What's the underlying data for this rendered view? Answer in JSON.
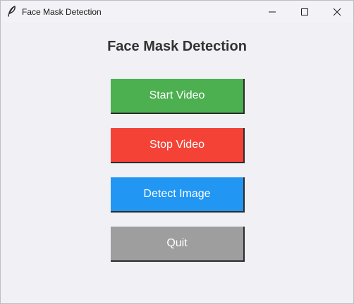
{
  "window": {
    "title": "Face Mask Detection",
    "icon": "feather-icon"
  },
  "main": {
    "heading": "Face Mask Detection",
    "buttons": [
      {
        "label": "Start Video",
        "color": "#4caf50"
      },
      {
        "label": "Stop Video",
        "color": "#f44336"
      },
      {
        "label": "Detect Image",
        "color": "#2196f3"
      },
      {
        "label": "Quit",
        "color": "#9e9e9e"
      }
    ]
  }
}
